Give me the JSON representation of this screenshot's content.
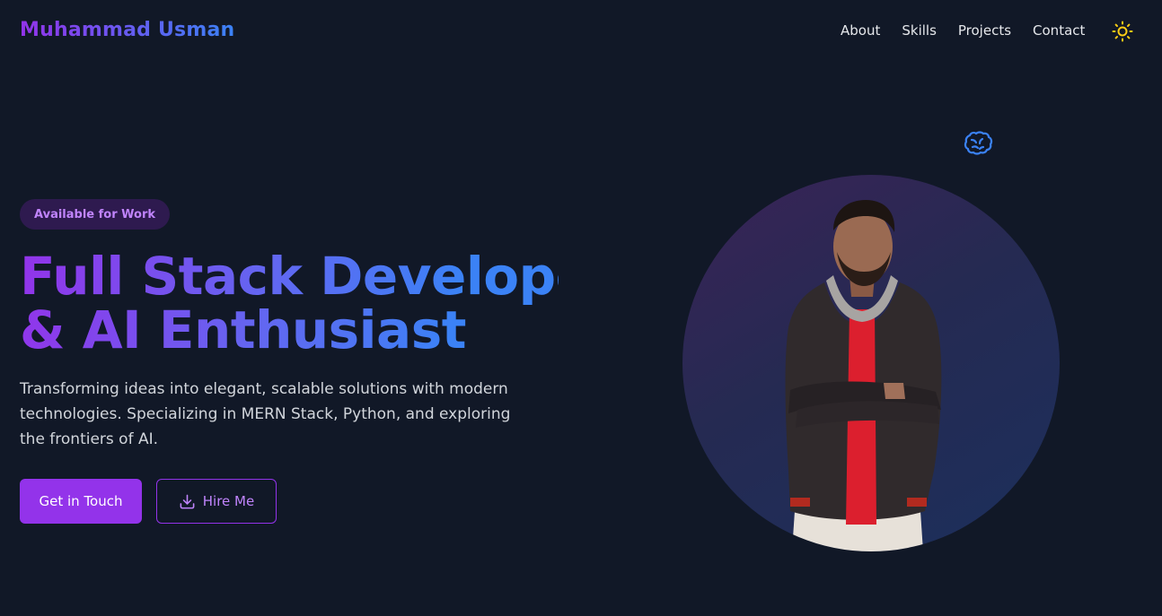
{
  "header": {
    "brand": "Muhammad Usman",
    "nav": [
      {
        "label": "About"
      },
      {
        "label": "Skills"
      },
      {
        "label": "Projects"
      },
      {
        "label": "Contact"
      }
    ],
    "theme_icon": "sun-icon"
  },
  "hero": {
    "badge": "Available for Work",
    "headline_line1": "Full Stack Developer",
    "headline_line2": "& AI Enthusiast",
    "description": "Transforming ideas into elegant, scalable solutions with modern technologies. Specializing in MERN Stack, Python, and exploring the frontiers of AI.",
    "primary_button": "Get in Touch",
    "secondary_button": "Hire Me",
    "secondary_button_icon": "download-icon",
    "floating_icon": "brain-icon"
  },
  "colors": {
    "background": "#111827",
    "accent_purple": "#9333ea",
    "accent_blue": "#3b82f6",
    "sun_yellow": "#facc15"
  }
}
